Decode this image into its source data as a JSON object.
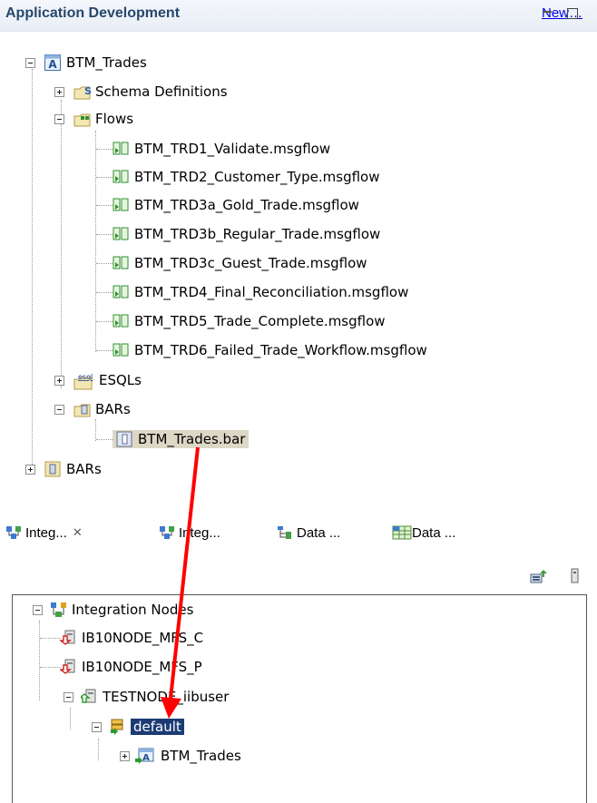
{
  "header": {
    "title": "Application Development",
    "new_link": "New…"
  },
  "tree": {
    "project": "BTM_Trades",
    "schema_definitions": "Schema Definitions",
    "flows": {
      "label": "Flows",
      "items": [
        "BTM_TRD1_Validate.msgflow",
        "BTM_TRD2_Customer_Type.msgflow",
        "BTM_TRD3a_Gold_Trade.msgflow",
        "BTM_TRD3b_Regular_Trade.msgflow",
        "BTM_TRD3c_Guest_Trade.msgflow",
        "BTM_TRD4_Final_Reconciliation.msgflow",
        "BTM_TRD5_Trade_Complete.msgflow",
        "BTM_TRD6_Failed_Trade_Workflow.msgflow"
      ]
    },
    "esqls": "ESQLs",
    "esql_icon_text": "esql",
    "bars": "BARs",
    "bar_file": "BTM_Trades.bar",
    "root_bars": "BARs"
  },
  "tabs": [
    {
      "label": "Integ...",
      "close": "✕"
    },
    {
      "label": "Integ..."
    },
    {
      "label": "Data ..."
    },
    {
      "label": "Data ..."
    }
  ],
  "nodes_tree": {
    "root": "Integration Nodes",
    "nodes": [
      "IB10NODE_MFS_C",
      "IB10NODE_MFS_P",
      "TESTNODE_iibuser"
    ],
    "server": "default",
    "app": "BTM_Trades"
  },
  "colors": {
    "header_title": "#27476c",
    "selection": "#1c3b74",
    "arrow": "#ff0000",
    "link": "#0000ee"
  }
}
